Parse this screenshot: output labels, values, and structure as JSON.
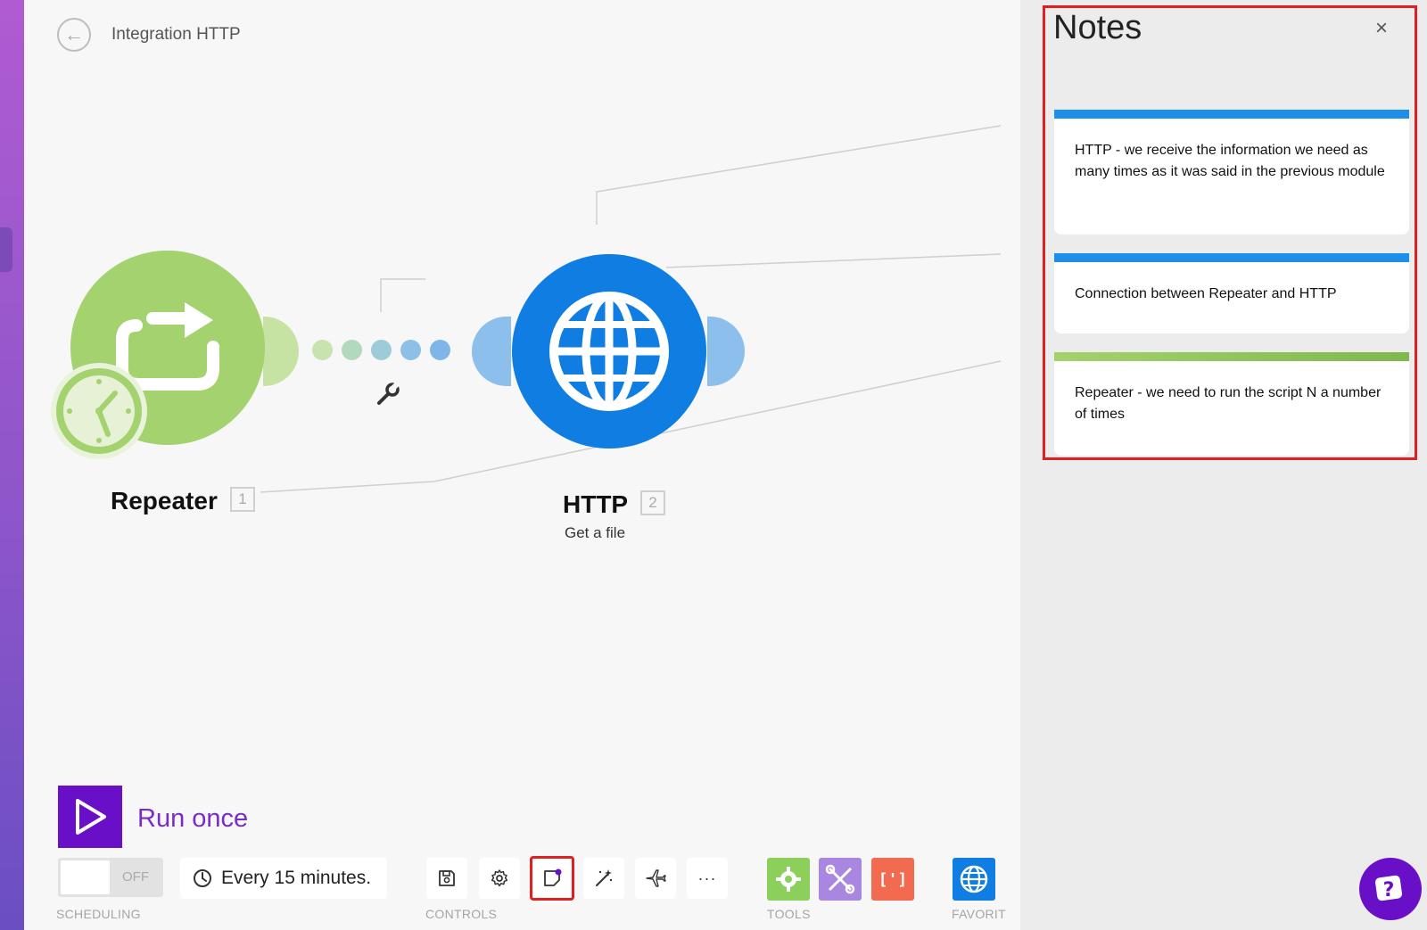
{
  "header": {
    "title": "Integration HTTP"
  },
  "modules": [
    {
      "name": "Repeater",
      "number": "1"
    },
    {
      "name": "HTTP",
      "number": "2",
      "subtitle": "Get a file"
    }
  ],
  "footer": {
    "run_label": "Run once",
    "scheduling": {
      "toggle_state": "OFF",
      "interval": "Every 15 minutes.",
      "section_label": "SCHEDULING"
    },
    "controls_label": "CONTROLS",
    "tools_label": "TOOLS",
    "favorites_label": "FAVORIT"
  },
  "notes": {
    "title": "Notes",
    "close": "×",
    "items": [
      {
        "text": "HTTP - we receive the information we need as many times as it was said in the previous module",
        "color": "#1e8fe8"
      },
      {
        "text": "Connection between Repeater and HTTP",
        "color": "#1e8fe8"
      },
      {
        "text": "Repeater - we need to run the script N a number of times",
        "color": "#8fc45a"
      }
    ]
  },
  "colors": {
    "repeater": "#a3d26f",
    "http": "#0f7de1",
    "accent": "#6a0fc8",
    "highlight": "#e02020",
    "tool_green": "#8ccf5a",
    "tool_purple": "#a987e0",
    "tool_orange": "#f26a4f",
    "tool_blue": "#0f7de1"
  }
}
